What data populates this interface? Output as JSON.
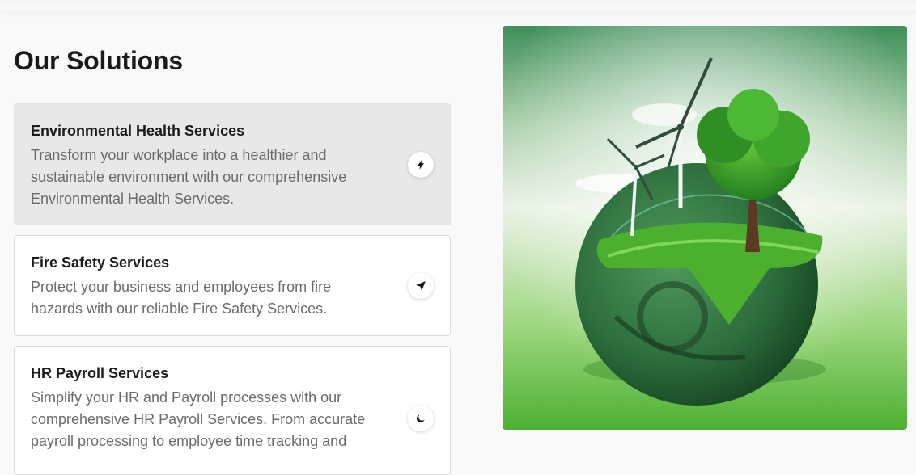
{
  "section": {
    "title": "Our Solutions"
  },
  "solutions": [
    {
      "title": "Environmental Health Services",
      "description": "Transform your workplace into a healthier and sustainable environment with our comprehensive Environmental Health Services.",
      "icon": "lightning-bolt-icon",
      "active": true
    },
    {
      "title": "Fire Safety Services",
      "description": "Protect your business and employees from fire hazards with our reliable Fire Safety Services.",
      "icon": "navigation-arrow-icon",
      "active": false
    },
    {
      "title": "HR Payroll Services",
      "description": "Simplify your HR and Payroll processes with our comprehensive HR Payroll Services. From accurate payroll processing to employee time tracking and",
      "icon": "crescent-moon-icon",
      "active": false
    }
  ],
  "hero_image": {
    "subject": "green globe with tree, grass and wind turbines"
  },
  "colors": {
    "background": "#f9f9f9",
    "active_card": "#e8e8e8",
    "card": "#ffffff",
    "text_primary": "#1a1a1a",
    "text_secondary": "#6b6b6b",
    "accent_green": "#4caf2e"
  }
}
